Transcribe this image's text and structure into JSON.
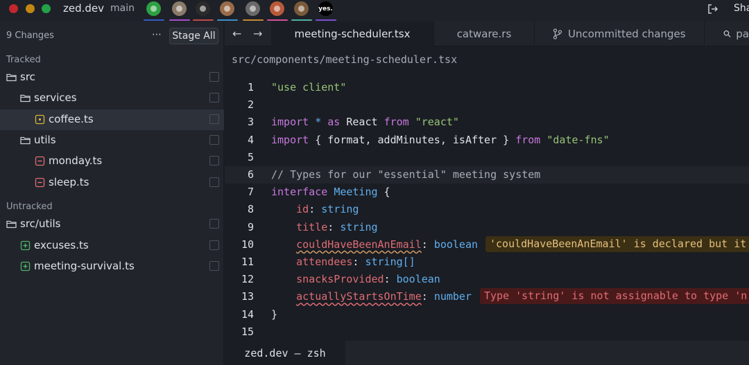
{
  "titlebar": {
    "project": "zed.dev",
    "branch": "main",
    "share_label": "Sha",
    "collaborators": [
      {
        "name": "avatar-green-robot",
        "color": "#2ea043",
        "bar": "#2f5cc8"
      },
      {
        "name": "avatar-person-1",
        "color": "#8a7a6a",
        "bar": "#a84ccd"
      },
      {
        "name": "avatar-dark-cat",
        "color": "#2b2b2b",
        "bar": "#c24b4b"
      },
      {
        "name": "avatar-person-2",
        "color": "#9a6a4a",
        "bar": "#3d8fd1"
      },
      {
        "name": "avatar-person-3",
        "color": "#6a6a6a",
        "bar": "#c88a2e"
      },
      {
        "name": "avatar-person-4",
        "color": "#b85a3a",
        "bar": "#d44f9b"
      },
      {
        "name": "avatar-person-5",
        "color": "#7a5a3a",
        "bar": "#4db0a2"
      },
      {
        "name": "avatar-yes",
        "color": "#000000",
        "bar": "#7a4fd4",
        "text": "yes."
      }
    ]
  },
  "git_panel": {
    "changes_count": "9 Changes",
    "stage_all_label": "Stage All",
    "tracked_label": "Tracked",
    "untracked_label": "Untracked",
    "items": [
      {
        "label": "src",
        "kind": "folder",
        "indent": 0
      },
      {
        "label": "services",
        "kind": "folder",
        "indent": 1
      },
      {
        "label": "coffee.ts",
        "kind": "modified",
        "indent": 2
      },
      {
        "label": "utils",
        "kind": "folder",
        "indent": 1
      },
      {
        "label": "monday.ts",
        "kind": "deleted",
        "indent": 2
      },
      {
        "label": "sleep.ts",
        "kind": "deleted",
        "indent": 2
      },
      {
        "label": "src/utils",
        "kind": "folder",
        "indent": 0
      },
      {
        "label": "excuses.ts",
        "kind": "added",
        "indent": 1
      },
      {
        "label": "meeting-survival.ts",
        "kind": "added",
        "indent": 1
      }
    ]
  },
  "tabs": [
    {
      "label": "meeting-scheduler.tsx",
      "active": true
    },
    {
      "label": "catware.rs",
      "active": false
    },
    {
      "label": "Uncommitted changes",
      "active": false,
      "icon": "git-branch-icon"
    },
    {
      "label": "pa",
      "active": false,
      "icon": "search-icon"
    }
  ],
  "editor": {
    "breadcrumb": "src/components/meeting-scheduler.tsx",
    "current_line": 6,
    "lines": [
      {
        "n": "1",
        "tokens": [
          {
            "t": "\"use client\"",
            "c": "str"
          }
        ]
      },
      {
        "n": "2",
        "tokens": []
      },
      {
        "n": "3",
        "tokens": [
          {
            "t": "import",
            "c": "kw"
          },
          {
            "t": " ",
            "c": "pl"
          },
          {
            "t": "*",
            "c": "ty"
          },
          {
            "t": " ",
            "c": "pl"
          },
          {
            "t": "as",
            "c": "kw"
          },
          {
            "t": " React ",
            "c": "pl"
          },
          {
            "t": "from",
            "c": "kw"
          },
          {
            "t": " ",
            "c": "pl"
          },
          {
            "t": "\"react\"",
            "c": "str"
          }
        ]
      },
      {
        "n": "4",
        "tokens": [
          {
            "t": "import",
            "c": "kw"
          },
          {
            "t": " { format, addMinutes, isAfter } ",
            "c": "pl"
          },
          {
            "t": "from",
            "c": "kw"
          },
          {
            "t": " ",
            "c": "pl"
          },
          {
            "t": "\"date-fns\"",
            "c": "str"
          }
        ]
      },
      {
        "n": "5",
        "tokens": []
      },
      {
        "n": "6",
        "tokens": [
          {
            "t": "// Types for our \"essential\" meeting system",
            "c": "cm"
          }
        ]
      },
      {
        "n": "7",
        "tokens": [
          {
            "t": "interface",
            "c": "kw"
          },
          {
            "t": " ",
            "c": "pl"
          },
          {
            "t": "Meeting",
            "c": "ty"
          },
          {
            "t": " {",
            "c": "pl"
          }
        ]
      },
      {
        "n": "8",
        "tokens": [
          {
            "t": "    ",
            "c": "pl"
          },
          {
            "t": "id",
            "c": "id"
          },
          {
            "t": ": ",
            "c": "pl"
          },
          {
            "t": "string",
            "c": "ty"
          }
        ]
      },
      {
        "n": "9",
        "tokens": [
          {
            "t": "    ",
            "c": "pl"
          },
          {
            "t": "title",
            "c": "id"
          },
          {
            "t": ": ",
            "c": "pl"
          },
          {
            "t": "string",
            "c": "ty"
          }
        ]
      },
      {
        "n": "10",
        "tokens": [
          {
            "t": "    ",
            "c": "pl"
          },
          {
            "t": "couldHaveBeenAnEmail",
            "c": "id sq-warn"
          },
          {
            "t": ": ",
            "c": "pl"
          },
          {
            "t": "boolean",
            "c": "ty"
          }
        ],
        "diagnostic": {
          "kind": "warn",
          "text": "'couldHaveBeenAnEmail' is declared but it"
        }
      },
      {
        "n": "11",
        "tokens": [
          {
            "t": "    ",
            "c": "pl"
          },
          {
            "t": "attendees",
            "c": "id"
          },
          {
            "t": ": ",
            "c": "pl"
          },
          {
            "t": "string[]",
            "c": "ty"
          }
        ]
      },
      {
        "n": "12",
        "tokens": [
          {
            "t": "    ",
            "c": "pl"
          },
          {
            "t": "snacksProvided",
            "c": "id"
          },
          {
            "t": ": ",
            "c": "pl"
          },
          {
            "t": "boolean",
            "c": "ty"
          }
        ]
      },
      {
        "n": "13",
        "tokens": [
          {
            "t": "    ",
            "c": "pl"
          },
          {
            "t": "actuallyStartsOnTime",
            "c": "id sq-err"
          },
          {
            "t": ": ",
            "c": "pl"
          },
          {
            "t": "number",
            "c": "ty"
          }
        ],
        "diagnostic": {
          "kind": "err",
          "text": "Type 'string' is not assignable to type 'n"
        }
      },
      {
        "n": "14",
        "tokens": [
          {
            "t": "}",
            "c": "pl"
          }
        ]
      },
      {
        "n": "15",
        "tokens": []
      }
    ]
  },
  "terminal": {
    "tab_label": "zed.dev — zsh"
  }
}
